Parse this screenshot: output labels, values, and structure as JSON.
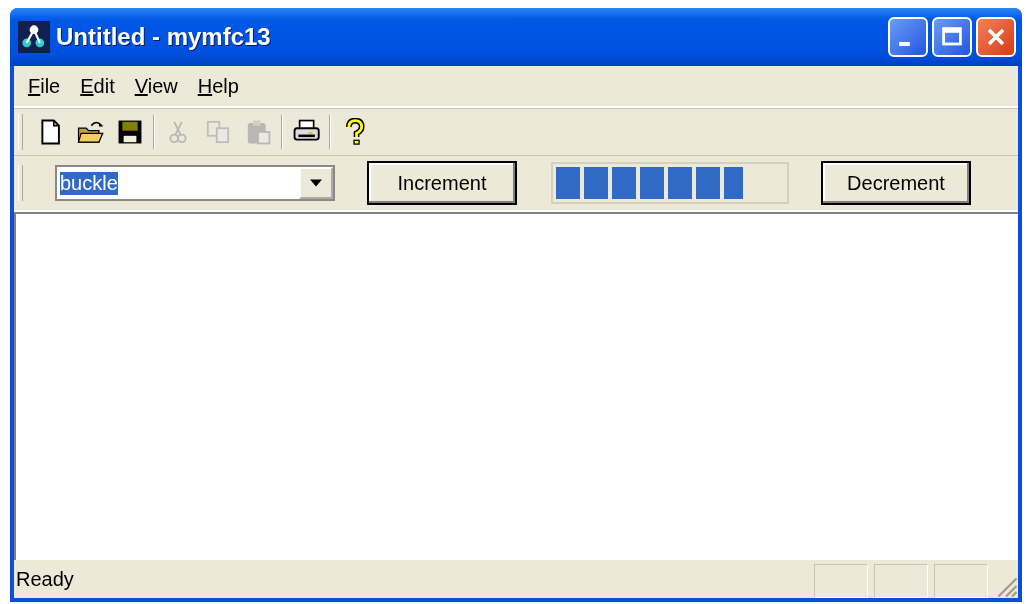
{
  "window": {
    "title": "Untitled - mymfc13"
  },
  "menu": [
    {
      "label": "File"
    },
    {
      "label": "Edit"
    },
    {
      "label": "View"
    },
    {
      "label": "Help"
    }
  ],
  "toolbar": [
    {
      "kind": "new",
      "disabled": false
    },
    {
      "kind": "open",
      "disabled": false
    },
    {
      "kind": "save",
      "disabled": false
    },
    {
      "kind": "separator"
    },
    {
      "kind": "cut",
      "disabled": true
    },
    {
      "kind": "copy",
      "disabled": true
    },
    {
      "kind": "paste",
      "disabled": true
    },
    {
      "kind": "separator"
    },
    {
      "kind": "print",
      "disabled": false
    },
    {
      "kind": "separator"
    },
    {
      "kind": "help",
      "disabled": false
    }
  ],
  "dialog_bar": {
    "combo": {
      "value": "buckle",
      "selected": true
    },
    "increment_button": "Increment",
    "progress": {
      "level": 0.82
    },
    "decrement_button": "Decrement"
  },
  "status_bar": {
    "text": "Ready"
  }
}
